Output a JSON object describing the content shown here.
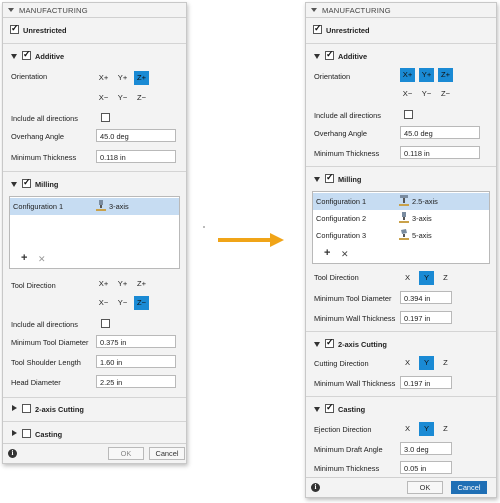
{
  "title": "MANUFACTURING",
  "left": {
    "unrestricted": "Unrestricted",
    "additive": {
      "header": "Additive",
      "orientation_label": "Orientation",
      "buttons_row1": [
        "X+",
        "Y+",
        "Z+"
      ],
      "buttons_row2": [
        "X−",
        "Y−",
        "Z−"
      ],
      "active": "Z+",
      "include_all": "Include all directions",
      "overhang_label": "Overhang Angle",
      "overhang_value": "45.0 deg",
      "min_thickness_label": "Minimum Thickness",
      "min_thickness_value": "0.118 in"
    },
    "milling": {
      "header": "Milling",
      "configs": [
        {
          "name": "Configuration 1",
          "type": "3-axis",
          "icon": "3-axis-mill-icon"
        }
      ],
      "tool_direction_label": "Tool Direction",
      "buttons_row1": [
        "X+",
        "Y+",
        "Z+"
      ],
      "buttons_row2": [
        "X−",
        "Y−",
        "Z−"
      ],
      "active": "Z−",
      "include_all": "Include all directions",
      "min_tool_diameter_label": "Minimum Tool Diameter",
      "min_tool_diameter_value": "0.375 in",
      "tool_shoulder_label": "Tool Shoulder Length",
      "tool_shoulder_value": "1.60 in",
      "head_diameter_label": "Head Diameter",
      "head_diameter_value": "2.25 in"
    },
    "cutting_header": "2-axis Cutting",
    "casting_header": "Casting",
    "ok": "OK",
    "cancel": "Cancel"
  },
  "right": {
    "unrestricted": "Unrestricted",
    "additive": {
      "header": "Additive",
      "orientation_label": "Orientation",
      "buttons_row1": [
        "X+",
        "Y+",
        "Z+"
      ],
      "buttons_row2": [
        "X−",
        "Y−",
        "Z−"
      ],
      "active": [
        "X+",
        "Y+",
        "Z+"
      ],
      "include_all": "Include all directions",
      "overhang_label": "Overhang Angle",
      "overhang_value": "45.0 deg",
      "min_thickness_label": "Minimum Thickness",
      "min_thickness_value": "0.118 in"
    },
    "milling": {
      "header": "Milling",
      "configs": [
        {
          "name": "Configuration 1",
          "type": "2.5-axis",
          "icon": "2-5-axis-mill-icon"
        },
        {
          "name": "Configuration 2",
          "type": "3-axis",
          "icon": "3-axis-mill-icon"
        },
        {
          "name": "Configuration 3",
          "type": "5-axis",
          "icon": "5-axis-mill-icon"
        }
      ],
      "tool_direction_label": "Tool Direction",
      "xyz": [
        "X",
        "Y",
        "Z"
      ],
      "active": "Y",
      "min_tool_diameter_label": "Minimum Tool Diameter",
      "min_tool_diameter_value": "0.394 in",
      "min_wall_label": "Minimum Wall Thickness",
      "min_wall_value": "0.197 in"
    },
    "cutting": {
      "header": "2-axis Cutting",
      "direction_label": "Cutting Direction",
      "xyz": [
        "X",
        "Y",
        "Z"
      ],
      "active": "Y",
      "min_wall_label": "Minimum Wall Thickness",
      "min_wall_value": "0.197 in"
    },
    "casting": {
      "header": "Casting",
      "direction_label": "Ejection Direction",
      "xyz": [
        "X",
        "Y",
        "Z"
      ],
      "active": "Y",
      "draft_label": "Minimum Draft Angle",
      "draft_value": "3.0 deg",
      "min_thickness_label": "Minimum Thickness",
      "min_thickness_value": "0.05 in"
    },
    "ok": "OK",
    "cancel": "Cancel"
  },
  "colors": {
    "accent": "#1a8ad4",
    "arrow": "#f0a418",
    "selection": "#c6dcf2",
    "primary_button": "#1f6fb5"
  }
}
